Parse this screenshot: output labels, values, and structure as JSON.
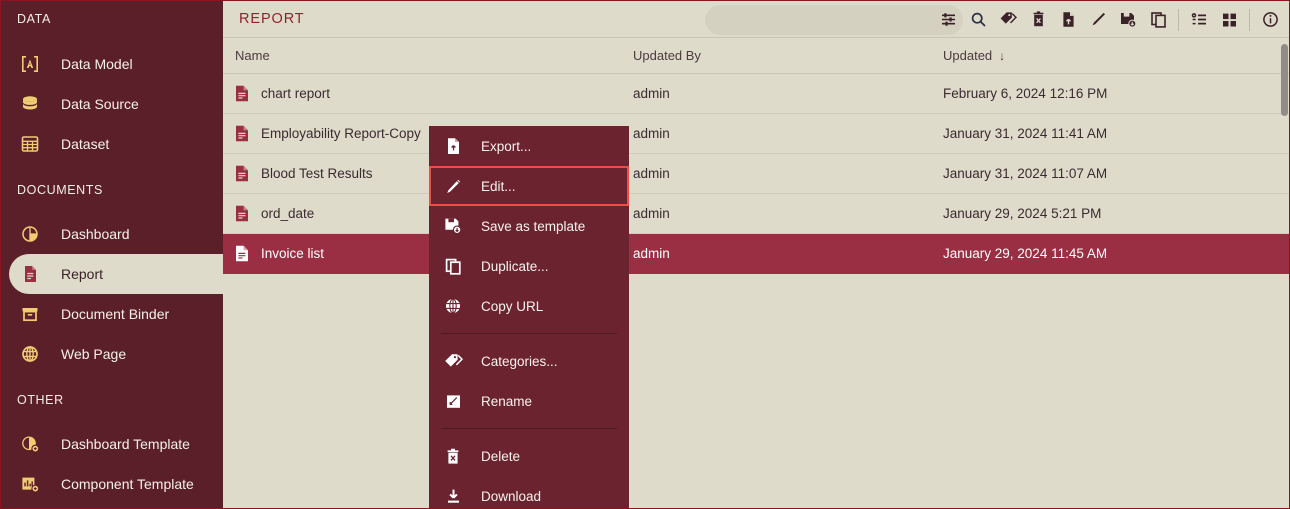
{
  "theme": {
    "sidebar_bg": "#5a1f29",
    "main_bg": "#dedbcb",
    "accent": "#8e2230",
    "selected_row_bg": "#9a2e42",
    "menu_bg": "#6b2330",
    "highlight_border": "#ef4e47",
    "icon_gold": "#f0cd72"
  },
  "sidebar": {
    "sections": [
      {
        "label": "DATA",
        "items": [
          {
            "label": "Data Model",
            "icon": "data-model-icon",
            "active": false
          },
          {
            "label": "Data Source",
            "icon": "database-icon",
            "active": false
          },
          {
            "label": "Dataset",
            "icon": "grid-table-icon",
            "active": false
          }
        ]
      },
      {
        "label": "DOCUMENTS",
        "items": [
          {
            "label": "Dashboard",
            "icon": "pie-chart-icon",
            "active": false
          },
          {
            "label": "Report",
            "icon": "document-icon",
            "active": true
          },
          {
            "label": "Document Binder",
            "icon": "binder-icon",
            "active": false
          },
          {
            "label": "Web Page",
            "icon": "globe-icon",
            "active": false
          }
        ]
      },
      {
        "label": "OTHER",
        "items": [
          {
            "label": "Dashboard Template",
            "icon": "dashboard-template-icon",
            "active": false
          },
          {
            "label": "Component Template",
            "icon": "component-template-icon",
            "active": false
          }
        ]
      }
    ]
  },
  "header": {
    "title": "REPORT",
    "search_placeholder": "",
    "search_value": "",
    "toolbar": [
      {
        "name": "filter-settings-icon",
        "label": "Filter settings"
      },
      {
        "name": "search-icon",
        "label": "Search"
      },
      {
        "name": "tag-icon",
        "label": "Categories"
      },
      {
        "name": "trash-icon",
        "label": "Delete"
      },
      {
        "name": "file-export-icon",
        "label": "Export"
      },
      {
        "name": "pencil-icon",
        "label": "Edit"
      },
      {
        "name": "save-template-icon",
        "label": "Save as template"
      },
      {
        "name": "duplicate-icon",
        "label": "Duplicate"
      },
      {
        "name": "list-view-icon",
        "label": "List view"
      },
      {
        "name": "grid-view-icon",
        "label": "Grid view"
      },
      {
        "name": "info-icon",
        "label": "Info"
      }
    ]
  },
  "table": {
    "columns": [
      {
        "key": "name",
        "label": "Name",
        "sorted": false
      },
      {
        "key": "updated_by",
        "label": "Updated By",
        "sorted": false
      },
      {
        "key": "updated",
        "label": "Updated",
        "sorted": true,
        "sort_dir": "↓"
      }
    ],
    "rows": [
      {
        "name": "chart report",
        "updated_by": "admin",
        "updated": "February 6, 2024 12:16 PM",
        "selected": false
      },
      {
        "name": "Employability Report-Copy",
        "updated_by": "admin",
        "updated": "January 31, 2024 11:41 AM",
        "selected": false
      },
      {
        "name": "Blood Test Results",
        "updated_by": "admin",
        "updated": "January 31, 2024 11:07 AM",
        "selected": false
      },
      {
        "name": "ord_date",
        "updated_by": "admin",
        "updated": "January 29, 2024 5:21 PM",
        "selected": false
      },
      {
        "name": "Invoice list",
        "updated_by": "admin",
        "updated": "January 29, 2024 11:45 AM",
        "selected": true
      }
    ]
  },
  "context_menu": {
    "items": [
      {
        "label": "Export...",
        "icon": "file-export-icon",
        "highlight": false
      },
      {
        "label": "Edit...",
        "icon": "pencil-icon",
        "highlight": true
      },
      {
        "label": "Save as template",
        "icon": "save-template-icon",
        "highlight": false
      },
      {
        "label": "Duplicate...",
        "icon": "duplicate-icon",
        "highlight": false
      },
      {
        "label": "Copy URL",
        "icon": "globe-icon",
        "highlight": false
      },
      {
        "label": "Categories...",
        "icon": "tag-icon",
        "highlight": false
      },
      {
        "label": "Rename",
        "icon": "rename-icon",
        "highlight": false
      },
      {
        "label": "Delete",
        "icon": "trash-icon",
        "highlight": false
      },
      {
        "label": "Download",
        "icon": "download-icon",
        "highlight": false
      }
    ],
    "separators_after": [
      4,
      6
    ]
  }
}
